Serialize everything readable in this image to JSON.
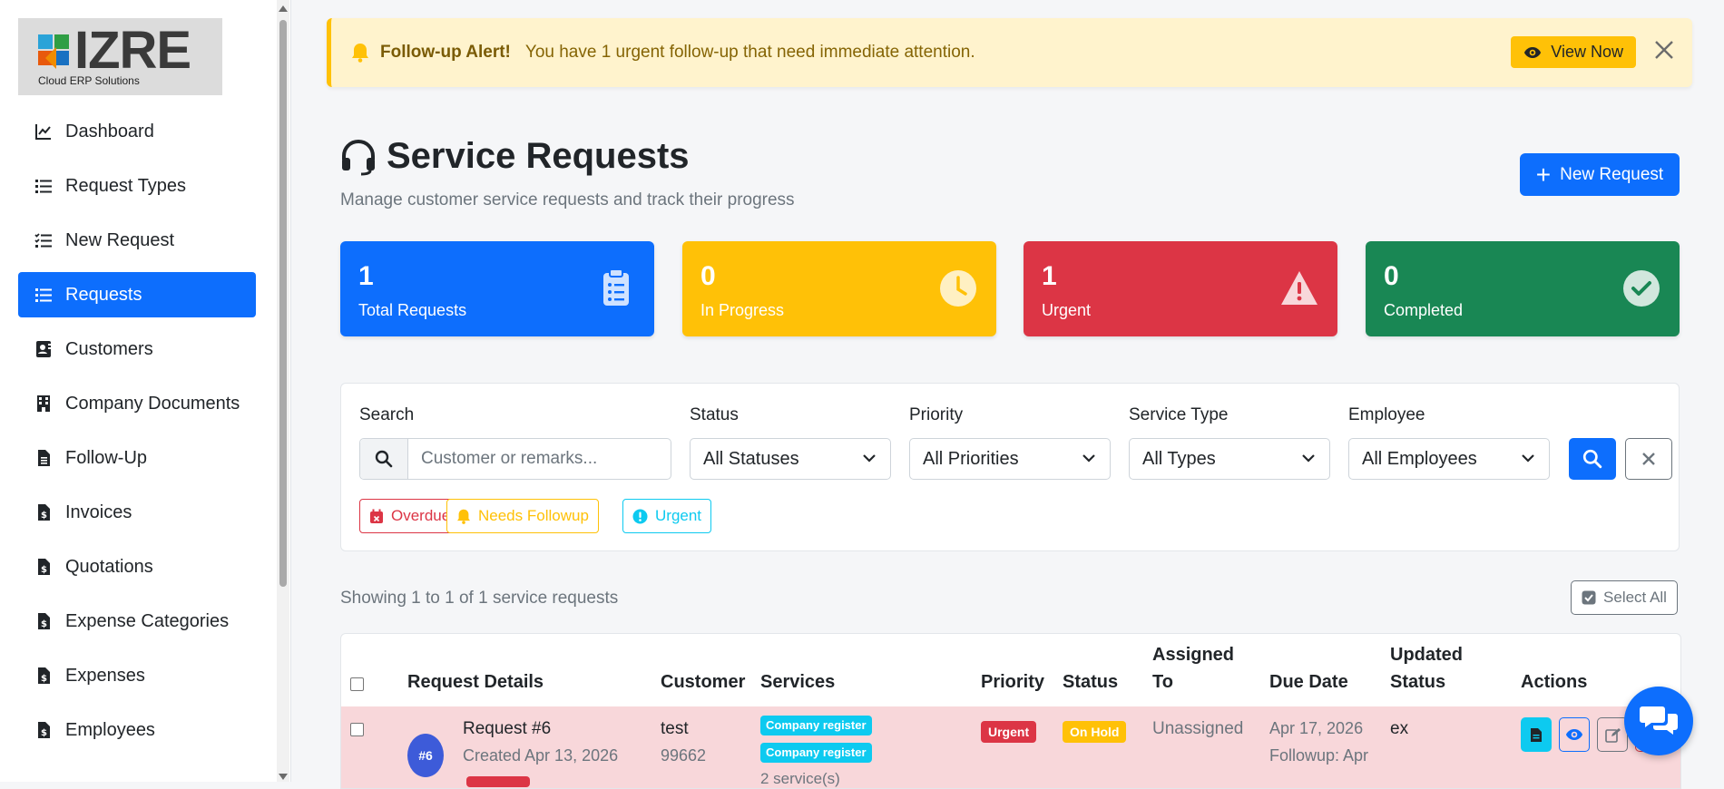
{
  "brand": {
    "logo_text": "IZRE",
    "logo_sub": "Cloud ERP Solutions"
  },
  "sidebar": {
    "items": [
      {
        "label": "Dashboard",
        "icon": "chart-line-icon"
      },
      {
        "label": "Request Types",
        "icon": "list-icon"
      },
      {
        "label": "New Request",
        "icon": "list-check-icon"
      },
      {
        "label": "Requests",
        "icon": "list-icon",
        "active": true
      },
      {
        "label": "Customers",
        "icon": "address-card-icon"
      },
      {
        "label": "Company Documents",
        "icon": "building-icon"
      },
      {
        "label": "Follow-Up",
        "icon": "file-icon"
      },
      {
        "label": "Invoices",
        "icon": "file-invoice-dollar-icon"
      },
      {
        "label": "Quotations",
        "icon": "file-invoice-dollar-icon"
      },
      {
        "label": "Expense Categories",
        "icon": "file-invoice-dollar-icon"
      },
      {
        "label": "Expenses",
        "icon": "file-invoice-dollar-icon"
      },
      {
        "label": "Employees",
        "icon": "file-invoice-dollar-icon"
      }
    ]
  },
  "alert": {
    "title": "Follow-up Alert!",
    "message": "You have 1 urgent follow-up that need immediate attention.",
    "button": "View Now"
  },
  "header": {
    "title": "Service Requests",
    "subtitle": "Manage customer service requests and track their progress",
    "new_request": "New Request"
  },
  "stats": [
    {
      "value": "1",
      "label": "Total Requests",
      "color": "#0d6efd"
    },
    {
      "value": "0",
      "label": "In Progress",
      "color": "#ffc107"
    },
    {
      "value": "1",
      "label": "Urgent",
      "color": "#dc3545"
    },
    {
      "value": "0",
      "label": "Completed",
      "color": "#198754"
    }
  ],
  "filters": {
    "search_label": "Search",
    "search_placeholder": "Customer or remarks...",
    "status_label": "Status",
    "status_value": "All Statuses",
    "priority_label": "Priority",
    "priority_value": "All Priorities",
    "service_type_label": "Service Type",
    "service_type_value": "All Types",
    "employee_label": "Employee",
    "employee_value": "All Employees",
    "chips": [
      "Overdue",
      "Needs Followup",
      "Urgent"
    ]
  },
  "results": {
    "showing": "Showing 1 to 1 of 1 service requests",
    "select_all": "Select All"
  },
  "table": {
    "headers": {
      "details": "Request Details",
      "customer": "Customer",
      "services": "Services",
      "priority": "Priority",
      "status": "Status",
      "assigned_1": "Assigned",
      "assigned_2": "To",
      "due": "Due Date",
      "updated_1": "Updated",
      "updated_2": "Status",
      "actions": "Actions"
    },
    "rows": [
      {
        "id_badge": "#6",
        "title": "Request #6",
        "created": "Created Apr 13, 2026",
        "customer": "test",
        "customer_sub": "99662",
        "services": [
          "Company register",
          "Company register"
        ],
        "services_count": "2 service(s)",
        "priority": "Urgent",
        "status": "On Hold",
        "assigned": "Unassigned",
        "due": "Apr 17, 2026",
        "followup": "Followup: Apr",
        "updated_status": "ex"
      }
    ]
  }
}
